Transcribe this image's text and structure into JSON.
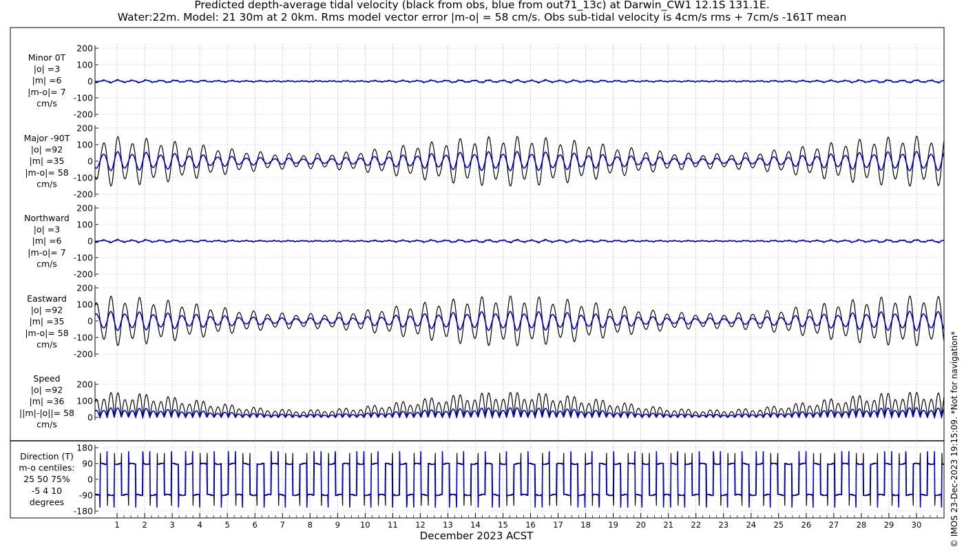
{
  "title": {
    "line1": "Predicted depth-average tidal velocity (black from obs, blue from out71_13c) at Darwin_CW1 12.1S 131.1E.",
    "line2": "Water:22m. Model: 21 30m at 2 0km. Rms model vector error |m-o| = 58 cm/s. Obs sub-tidal velocity is 4cm/s rms + 7cm/s -161T mean"
  },
  "xlabel": "December 2023 ACST",
  "side_text": "© IMOS 23-Dec-2023 19:15:09.  *Not for navigation*",
  "colors": {
    "obs": "#000000",
    "model": "#0000cc",
    "grid": "#999999"
  },
  "chart_data": [
    {
      "type": "line",
      "panel": "minor",
      "label": [
        "Minor 0T",
        "|o| =3",
        "|m| =6",
        "|m-o|= 7",
        "cm/s"
      ],
      "ylim": [
        -200,
        200
      ],
      "yticks": [
        200,
        100,
        0,
        -100,
        -200
      ],
      "amp": {
        "obs": 5,
        "model": 7
      },
      "phase_shift": 0.15,
      "kind": "osc",
      "series": [
        {
          "name": "obs",
          "color": "#000000"
        },
        {
          "name": "model",
          "color": "#0000cc"
        }
      ]
    },
    {
      "type": "line",
      "panel": "major",
      "label": [
        "Major -90T",
        "|o| =92",
        "|m| =35",
        "|m-o|= 58",
        "cm/s"
      ],
      "ylim": [
        -200,
        200
      ],
      "yticks": [
        200,
        100,
        0,
        -100,
        -200
      ],
      "amp": {
        "obs": 130,
        "model": 50
      },
      "phase_shift": 0.1,
      "kind": "osc",
      "series": [
        {
          "name": "obs",
          "color": "#000000"
        },
        {
          "name": "model",
          "color": "#0000cc"
        }
      ]
    },
    {
      "type": "line",
      "panel": "north",
      "label": [
        "Northward",
        "|o| =3",
        "|m| =6",
        "|m-o|= 7",
        "cm/s"
      ],
      "ylim": [
        -200,
        200
      ],
      "yticks": [
        200,
        100,
        0,
        -100,
        -200
      ],
      "amp": {
        "obs": 5,
        "model": 7
      },
      "phase_shift": 0.2,
      "kind": "osc",
      "series": [
        {
          "name": "obs",
          "color": "#000000"
        },
        {
          "name": "model",
          "color": "#0000cc"
        }
      ]
    },
    {
      "type": "line",
      "panel": "east",
      "label": [
        "Eastward",
        "|o| =92",
        "|m| =35",
        "|m-o|= 58",
        "cm/s"
      ],
      "ylim": [
        -200,
        200
      ],
      "yticks": [
        200,
        100,
        0,
        -100,
        -200
      ],
      "amp": {
        "obs": -130,
        "model": -50
      },
      "phase_shift": 0.1,
      "kind": "osc",
      "series": [
        {
          "name": "obs",
          "color": "#000000"
        },
        {
          "name": "model",
          "color": "#0000cc"
        }
      ]
    },
    {
      "type": "line",
      "panel": "speed",
      "label": [
        "Speed",
        "|o| =92",
        "|m| =36",
        "||m|-|o||= 58",
        "cm/s"
      ],
      "ylim": [
        0,
        200
      ],
      "yticks": [
        200,
        100,
        0
      ],
      "amp": {
        "obs": 130,
        "model": 50
      },
      "phase_shift": 0.1,
      "kind": "abs",
      "series": [
        {
          "name": "obs",
          "color": "#000000"
        },
        {
          "name": "model",
          "color": "#0000cc"
        }
      ]
    },
    {
      "type": "line",
      "panel": "direction",
      "label": [
        "Direction (T)",
        "m-o centiles:",
        "25  50  75%",
        "-5  4 10",
        "degrees"
      ],
      "ylim": [
        -180,
        180
      ],
      "yticks": [
        180,
        90,
        0,
        -90,
        -180
      ],
      "kind": "dir",
      "series": [
        {
          "name": "obs",
          "color": "#000000"
        },
        {
          "name": "model",
          "color": "#0000cc"
        }
      ]
    }
  ],
  "x_axis": {
    "start_day": 0.2,
    "end_day": 31.0,
    "ticks": [
      "1",
      "2",
      "3",
      "4",
      "5",
      "6",
      "7",
      "8",
      "9",
      "10",
      "11",
      "12",
      "13",
      "14",
      "15",
      "16",
      "17",
      "18",
      "19",
      "20",
      "21",
      "22",
      "23",
      "24",
      "25",
      "26",
      "27",
      "28",
      "29",
      "30"
    ]
  },
  "tide_model": {
    "semidiurnal_period_days": 0.5175,
    "spring_neap_period_days": 14.77,
    "envelope_min": 0.3,
    "spring_center_day": 15.2
  }
}
